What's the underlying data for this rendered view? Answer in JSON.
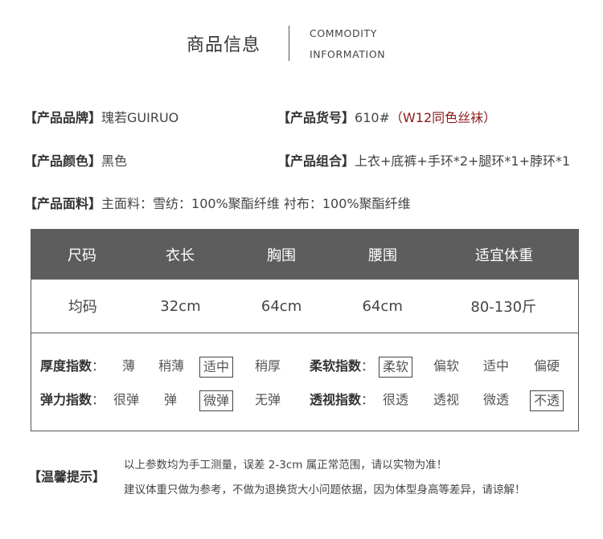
{
  "header": {
    "title_cn": "商品信息",
    "title_en_line1": "COMMODITY",
    "title_en_line2": "INFORMATION"
  },
  "info": {
    "brand_label": "【产品品牌】",
    "brand_value": "瑰若GUIRUO",
    "sku_label": "【产品货号】",
    "sku_value": "610#",
    "sku_note": "（W12同色丝袜）",
    "color_label": "【产品颜色】",
    "color_value": "黑色",
    "combo_label": "【产品组合】",
    "combo_value": "上衣+底裤+手环*2+腿环*1+脖环*1",
    "fabric_label": "【产品面料】",
    "fabric_value": "主面料：雪纺：100%聚酯纤维 衬布：100%聚酯纤维"
  },
  "size_table": {
    "headers": [
      "尺码",
      "衣长",
      "胸围",
      "腰围",
      "适宜体重"
    ],
    "rows": [
      [
        "均码",
        "32cm",
        "64cm",
        "64cm",
        "80-130斤"
      ]
    ]
  },
  "indices": {
    "thickness": {
      "label": "厚度指数",
      "options": [
        "薄",
        "稍薄",
        "适中",
        "稍厚"
      ],
      "selected": "适中"
    },
    "softness": {
      "label": "柔软指数",
      "options": [
        "柔软",
        "偏软",
        "适中",
        "偏硬"
      ],
      "selected": "柔软"
    },
    "elasticity": {
      "label": "弹力指数",
      "options": [
        "很弹",
        "弹",
        "微弹",
        "无弹"
      ],
      "selected": "微弹"
    },
    "transparency": {
      "label": "透视指数",
      "options": [
        "很透",
        "透视",
        "微透",
        "不透"
      ],
      "selected": "不透"
    },
    "colon": "："
  },
  "tips": {
    "label": "【温馨提示】",
    "line1": "以上参数均为手工测量，误差 2-3cm 属正常范围，请以实物为准！",
    "line2": "建议体重只做为参考，不做为退换货大小问题依据，因为体型身高等差异，请谅解！"
  }
}
